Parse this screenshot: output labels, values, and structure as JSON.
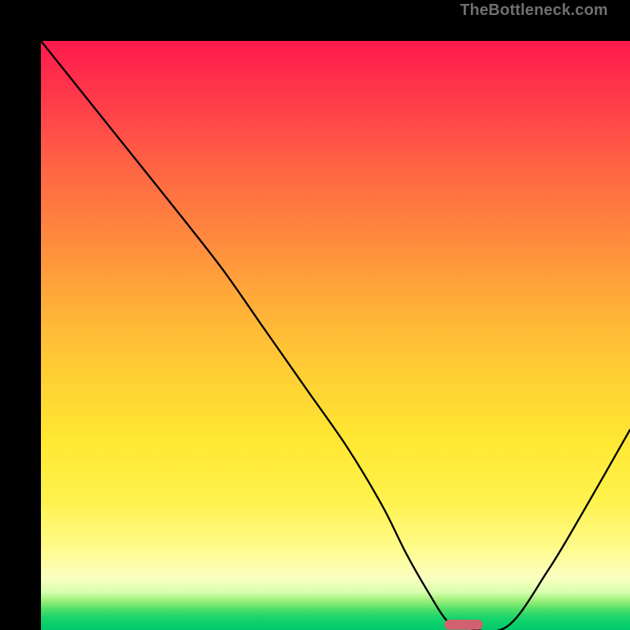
{
  "watermark": {
    "text": "TheBottleneck.com"
  },
  "chart_data": {
    "type": "line",
    "title": "",
    "xlabel": "",
    "ylabel": "",
    "xlim": [
      0,
      100
    ],
    "ylim": [
      0,
      100
    ],
    "grid": false,
    "legend": false,
    "series": [
      {
        "name": "bottleneck-curve",
        "x": [
          0,
          8,
          16,
          24,
          31,
          38,
          45,
          52,
          58,
          62,
          66,
          69,
          71.5,
          79,
          86,
          92,
          100
        ],
        "y": [
          100,
          90,
          80,
          70,
          61,
          51,
          41,
          31,
          21,
          13,
          6,
          1.5,
          0.5,
          0.5,
          10,
          20,
          34
        ]
      }
    ],
    "marker": {
      "name": "optimal-range",
      "shape": "rounded-bar",
      "color": "#d1626f",
      "x_start": 68.5,
      "x_end": 75.0,
      "y": 0.9,
      "height_pct": 1.7
    },
    "gradient_stops": [
      {
        "pct": 0,
        "color": "#ff1a4d"
      },
      {
        "pct": 34,
        "color": "#ff8b3e"
      },
      {
        "pct": 68,
        "color": "#ffe833"
      },
      {
        "pct": 91,
        "color": "#fcffc0"
      },
      {
        "pct": 100,
        "color": "#00c96c"
      }
    ]
  }
}
